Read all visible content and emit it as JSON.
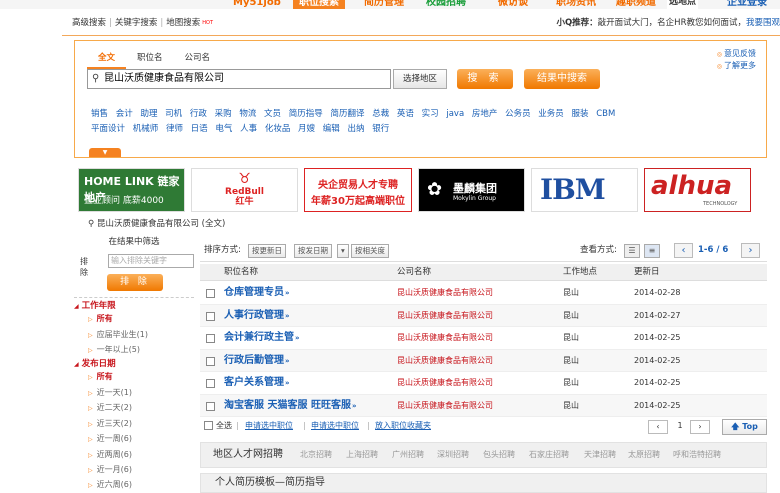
{
  "top_nav": {
    "items": [
      "My51job",
      "职位搜索",
      "简历管理",
      "校园招聘",
      "微访谈",
      "职场资讯",
      "趣职频道",
      "选地点",
      "企业登录"
    ],
    "active": "职位搜索"
  },
  "sub_nav": {
    "tabs": [
      "高级搜索",
      "关键字搜索",
      "地图搜索"
    ],
    "hot": "HOT",
    "recommend_label": "小Q推荐：",
    "recommend_text": "敲开面试大门，名企HR教您如何面试，",
    "recommend_link": "我要围观"
  },
  "search": {
    "tabs": [
      "全文",
      "职位名",
      "公司名"
    ],
    "active_tab": "全文",
    "query": "昆山沃质健康食品有限公司",
    "area_button": "选择地区",
    "search_button": "搜 索",
    "result_search_button": "结果中搜索",
    "links": [
      "意见反馈",
      "了解更多"
    ],
    "keywords": [
      "销售",
      "会计",
      "助理",
      "司机",
      "行政",
      "采购",
      "物流",
      "文员",
      "简历指导",
      "简历翻译",
      "总裁",
      "英语",
      "实习",
      "java",
      "房地产",
      "公务员",
      "业务员",
      "服装",
      "CBM",
      "平面设计",
      "机械师",
      "律师",
      "日语",
      "电气",
      "人事",
      "化妆品",
      "月嫂",
      "编辑",
      "出纳",
      "银行"
    ]
  },
  "banners": {
    "homelink": {
      "title": "HOME LINK 链家地产",
      "sub": "置业顾问 底薪4000"
    },
    "redbull": {
      "title": "RedBull",
      "sub": "红牛"
    },
    "central_trade": {
      "line1": "央企贸易人才专聘",
      "line2": "年薪30万起高端职位"
    },
    "mokylin": {
      "title": "墨麟集团",
      "sub": "Mokylin Group"
    },
    "ibm": {
      "title": "IBM"
    },
    "alhua": {
      "title": "alhua",
      "sub": "TECHNOLOGY"
    }
  },
  "crumb": "昆山沃质健康食品有限公司 (全文)",
  "sidebar": {
    "heading": "在结果中筛选",
    "filter_label": "排除",
    "filter_placeholder": "输入排除关键字",
    "exclude_button": "排 除",
    "groups": [
      {
        "title": "工作年限",
        "items": [
          "所有",
          "应届毕业生(1)",
          "一年以上(5)"
        ],
        "selected": 0
      },
      {
        "title": "发布日期",
        "items": [
          "所有",
          "近一天(1)",
          "近二天(2)",
          "近三天(2)",
          "近一周(6)",
          "近两周(6)",
          "近一月(6)",
          "近六周(6)"
        ],
        "selected": 0
      }
    ]
  },
  "results": {
    "sort_label": "排序方式:",
    "sort_options": [
      "按更新日",
      "按发日期",
      "按相关度"
    ],
    "view_label": "查看方式:",
    "page_info": "1-6 / 6",
    "headers": [
      "职位名称",
      "公司名称",
      "工作地点",
      "更新日"
    ],
    "rows": [
      {
        "job": "仓库管理专员",
        "company": "昆山沃质健康食品有限公司",
        "location": "昆山",
        "date": "2014-02-28"
      },
      {
        "job": "人事行政管理",
        "company": "昆山沃质健康食品有限公司",
        "location": "昆山",
        "date": "2014-02-27"
      },
      {
        "job": "会计兼行政主管",
        "company": "昆山沃质健康食品有限公司",
        "location": "昆山",
        "date": "2014-02-25"
      },
      {
        "job": "行政后勤管理",
        "company": "昆山沃质健康食品有限公司",
        "location": "昆山",
        "date": "2014-02-25"
      },
      {
        "job": "客户关系管理",
        "company": "昆山沃质健康食品有限公司",
        "location": "昆山",
        "date": "2014-02-25"
      },
      {
        "job": "淘宝客服  天猫客服  旺旺客服",
        "company": "昆山沃质健康食品有限公司",
        "location": "昆山",
        "date": "2014-02-25"
      }
    ],
    "select_all": "全选",
    "actions": [
      "申请选中职位",
      "申请选中职位",
      "放入职位收藏夹"
    ],
    "current_page": "1",
    "top_button": "Top"
  },
  "regions": {
    "heading": "地区人才网招聘",
    "cities": [
      "北京招聘",
      "上海招聘",
      "广州招聘",
      "深圳招聘",
      "包头招聘",
      "石家庄招聘",
      "天津招聘",
      "太原招聘",
      "呼和浩特招聘"
    ]
  },
  "resume_bar": "个人简历模板—简历指导",
  "colors": {
    "brand_orange": "#f58220",
    "link_blue": "#1a5fb4",
    "company_red": "#c7141b"
  }
}
